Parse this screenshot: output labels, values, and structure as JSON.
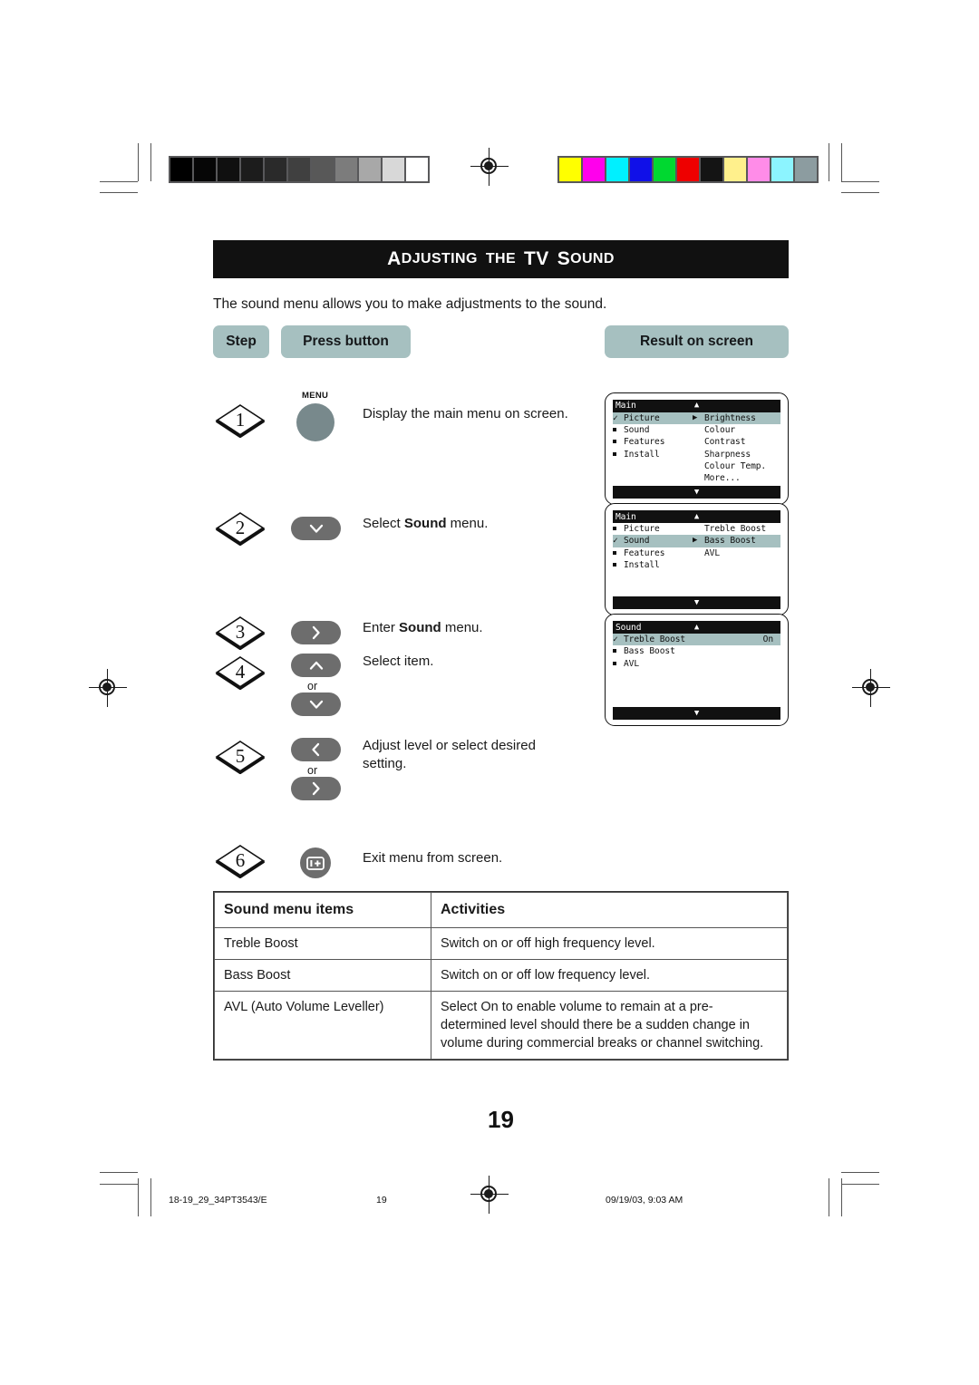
{
  "document": {
    "title_small_caps_1": "A",
    "title_rest_1": "DJUSTING",
    "title_small_caps_2": "THE",
    "title_tv": "TV",
    "title_small_caps_3": "S",
    "title_rest_3": "OUND",
    "title_full": "Adjusting the TV Sound",
    "intro": "The sound menu allows you to make adjustments to the sound.",
    "page_number": "19"
  },
  "headers": {
    "step": "Step",
    "press_button": "Press button",
    "result_on_screen": "Result on screen"
  },
  "steps": [
    {
      "number": "1",
      "button_label": "MENU",
      "button_type": "round",
      "text_prefix": "Display the main menu on screen.",
      "text_bold": "",
      "text_suffix": ""
    },
    {
      "number": "2",
      "button_label": "",
      "button_type": "chevron-down",
      "text_prefix": "Select ",
      "text_bold": "Sound",
      "text_suffix": " menu."
    },
    {
      "number": "3",
      "button_label": "",
      "button_type": "chevron-right",
      "text_prefix": "Enter ",
      "text_bold": "Sound",
      "text_suffix": " menu."
    },
    {
      "number": "4",
      "button_label": "",
      "button_type": "chevron-up-or-down",
      "or_label": "or",
      "text_prefix": "Select item.",
      "text_bold": "",
      "text_suffix": ""
    },
    {
      "number": "5",
      "button_label": "",
      "button_type": "chevron-left-or-right",
      "or_label": "or",
      "text_prefix": "Adjust level or select desired setting.",
      "text_bold": "",
      "text_suffix": ""
    },
    {
      "number": "6",
      "button_label": "",
      "button_type": "exit-info",
      "text_prefix": "Exit menu from screen.",
      "text_bold": "",
      "text_suffix": ""
    }
  ],
  "tv_screens": [
    {
      "title": "Main",
      "up_arrow": "▲",
      "down_arrow": "▼",
      "rows": [
        {
          "bullet": "check",
          "left": "Picture",
          "arrow": "▶",
          "right": "Brightness",
          "highlight": true
        },
        {
          "bullet": "square",
          "left": "Sound",
          "arrow": "",
          "right": "Colour",
          "highlight": false
        },
        {
          "bullet": "square",
          "left": "Features",
          "arrow": "",
          "right": "Contrast",
          "highlight": false
        },
        {
          "bullet": "square",
          "left": "Install",
          "arrow": "",
          "right": "Sharpness",
          "highlight": false
        },
        {
          "bullet": "none",
          "left": "",
          "arrow": "",
          "right": "Colour Temp.",
          "highlight": false
        },
        {
          "bullet": "none",
          "left": "",
          "arrow": "",
          "right": "More...",
          "highlight": false
        }
      ]
    },
    {
      "title": "Main",
      "up_arrow": "▲",
      "down_arrow": "▼",
      "rows": [
        {
          "bullet": "square",
          "left": "Picture",
          "arrow": "",
          "right": "Treble Boost",
          "highlight": false
        },
        {
          "bullet": "check",
          "left": "Sound",
          "arrow": "▶",
          "right": "Bass Boost",
          "highlight": true
        },
        {
          "bullet": "square",
          "left": "Features",
          "arrow": "",
          "right": "AVL",
          "highlight": false
        },
        {
          "bullet": "square",
          "left": "Install",
          "arrow": "",
          "right": "",
          "highlight": false
        },
        {
          "bullet": "none",
          "left": "",
          "arrow": "",
          "right": "",
          "highlight": false
        },
        {
          "bullet": "none",
          "left": "",
          "arrow": "",
          "right": "",
          "highlight": false
        }
      ]
    },
    {
      "title": "Sound",
      "up_arrow": "▲",
      "down_arrow": "▼",
      "rows": [
        {
          "bullet": "check",
          "left": "Treble Boost",
          "arrow": "",
          "right": "",
          "value": "On",
          "highlight": true
        },
        {
          "bullet": "square",
          "left": "Bass Boost",
          "arrow": "",
          "right": "",
          "value": "",
          "highlight": false
        },
        {
          "bullet": "square",
          "left": "AVL",
          "arrow": "",
          "right": "",
          "value": "",
          "highlight": false
        },
        {
          "bullet": "none",
          "left": "",
          "arrow": "",
          "right": "",
          "value": "",
          "highlight": false
        },
        {
          "bullet": "none",
          "left": "",
          "arrow": "",
          "right": "",
          "value": "",
          "highlight": false
        },
        {
          "bullet": "none",
          "left": "",
          "arrow": "",
          "right": "",
          "value": "",
          "highlight": false
        }
      ]
    }
  ],
  "table": {
    "headers": [
      "Sound menu items",
      "Activities"
    ],
    "rows": [
      [
        "Treble Boost",
        "Switch on or off high frequency level."
      ],
      [
        "Bass Boost",
        "Switch on or off low frequency level."
      ],
      [
        "AVL (Auto Volume Leveller)",
        "Select On to enable volume to remain at a pre-determined level should there be a sudden change in volume during commercial breaks or channel switching."
      ]
    ]
  },
  "footer": {
    "filename": "18-19_29_34PT3543/E",
    "page": "19",
    "timestamp": "09/19/03, 9:03 AM"
  },
  "calibration": {
    "grayscale": [
      "#000000",
      "#060606",
      "#101010",
      "#1c1c1c",
      "#2a2a2a",
      "#404040",
      "#585858",
      "#7c7c7c",
      "#a8a8a8",
      "#d8d8d8",
      "#ffffff"
    ],
    "colors": [
      "#ffff00",
      "#ff00ec",
      "#00f0ff",
      "#1010e8",
      "#00d830",
      "#ee0000",
      "#141414",
      "#fff08c",
      "#ff8ce8",
      "#8cf4ff",
      "#8c9ca0"
    ]
  }
}
